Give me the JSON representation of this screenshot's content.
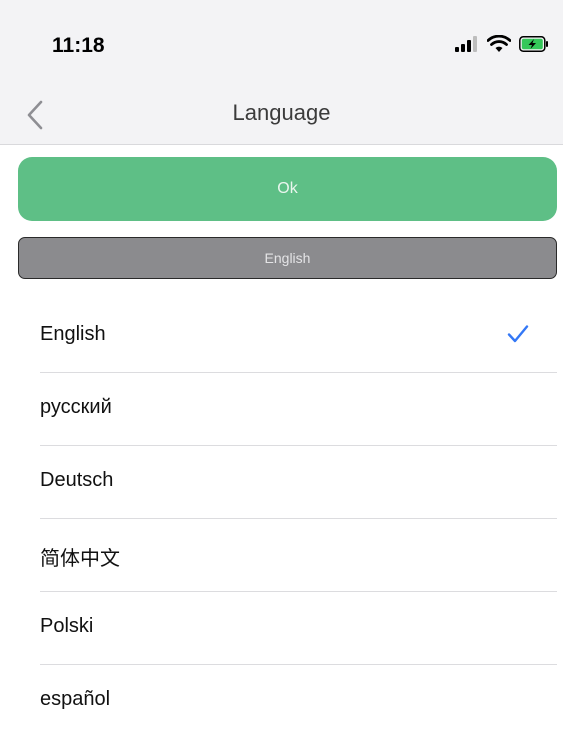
{
  "status": {
    "time": "11:18",
    "icons": [
      "signal-icon",
      "wifi-icon",
      "battery-charging-icon"
    ],
    "colors": {
      "battery": "#34c759"
    }
  },
  "nav": {
    "title": "Language",
    "back_icon": "chevron-left-icon"
  },
  "actions": {
    "ok_label": "Ok",
    "ok_color": "#5ebf86"
  },
  "selection": {
    "current": "English"
  },
  "languages": [
    {
      "label": "English",
      "selected": true
    },
    {
      "label": "русский",
      "selected": false
    },
    {
      "label": "Deutsch",
      "selected": false
    },
    {
      "label": "简体中文",
      "selected": false
    },
    {
      "label": "Polski",
      "selected": false
    },
    {
      "label": "español",
      "selected": false
    }
  ],
  "accent_color": "#3478f6"
}
